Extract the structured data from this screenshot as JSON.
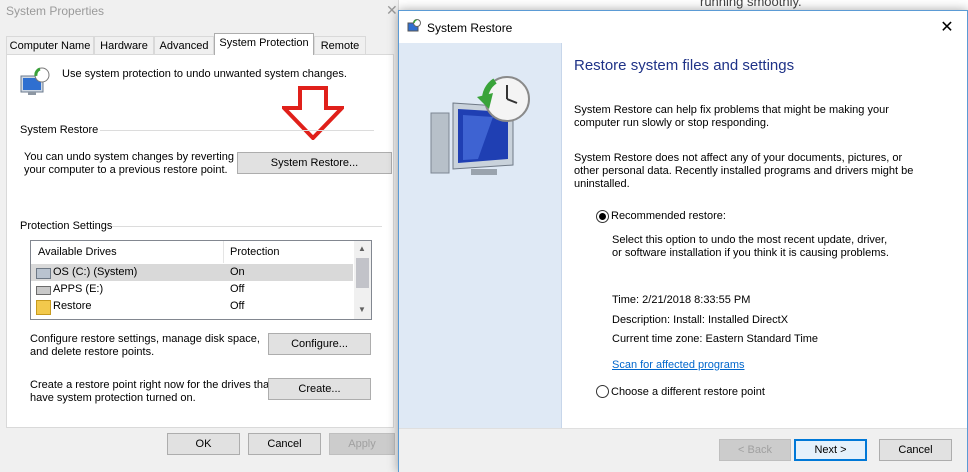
{
  "behind_text": "running smoothly.",
  "system_properties": {
    "title": "System Properties",
    "close_glyph": "✕",
    "tabs": [
      {
        "label": "Computer Name"
      },
      {
        "label": "Hardware"
      },
      {
        "label": "Advanced"
      },
      {
        "label": "System Protection",
        "active": true
      },
      {
        "label": "Remote"
      }
    ],
    "intro_text": "Use system protection to undo unwanted system changes.",
    "system_restore_group": {
      "title": "System Restore",
      "desc_line1": "You can undo system changes by reverting",
      "desc_line2": "your computer to a previous restore point.",
      "button_label": "System Restore..."
    },
    "protection_group": {
      "title": "Protection Settings",
      "columns": [
        "Available Drives",
        "Protection"
      ],
      "rows": [
        {
          "drive": "OS (C:) (System)",
          "protection": "On",
          "icon": "system-drive-icon"
        },
        {
          "drive": "APPS (E:)",
          "protection": "Off",
          "icon": "drive-icon"
        },
        {
          "drive": "Restore",
          "protection": "Off",
          "icon": "folder-icon"
        }
      ],
      "configure_text_line1": "Configure restore settings, manage disk space,",
      "configure_text_line2": "and delete restore points.",
      "configure_button": "Configure...",
      "create_text_line1": "Create a restore point right now for the drives that",
      "create_text_line2": "have system protection turned on.",
      "create_button": "Create..."
    },
    "buttons": {
      "ok": "OK",
      "cancel": "Cancel",
      "apply": "Apply"
    }
  },
  "system_restore": {
    "title": "System Restore",
    "close_glyph": "✕",
    "heading": "Restore system files and settings",
    "para1_line1": "System Restore can help fix problems that might be making your",
    "para1_line2": "computer run slowly or stop responding.",
    "para2_line1": "System Restore does not affect any of your documents, pictures, or",
    "para2_line2": "other personal data. Recently installed programs and drivers might be",
    "para2_line3": "uninstalled.",
    "recommended_label": "Recommended restore:",
    "recommended_desc_line1": "Select this option to undo the most recent update, driver,",
    "recommended_desc_line2": "or software installation if you think it is causing problems.",
    "time_label": "Time: 2/21/2018 8:33:55 PM",
    "description_label": "Description: Install: Installed DirectX",
    "timezone_label": "Current time zone: Eastern Standard Time",
    "scan_link": "Scan for affected programs",
    "different_label": "Choose a different restore point",
    "buttons": {
      "back": "< Back",
      "next": "Next >",
      "cancel": "Cancel"
    }
  },
  "colors": {
    "accent": "#0078d7",
    "heading": "#1e3287",
    "link": "#0066cc",
    "arrow": "#e0201a"
  }
}
